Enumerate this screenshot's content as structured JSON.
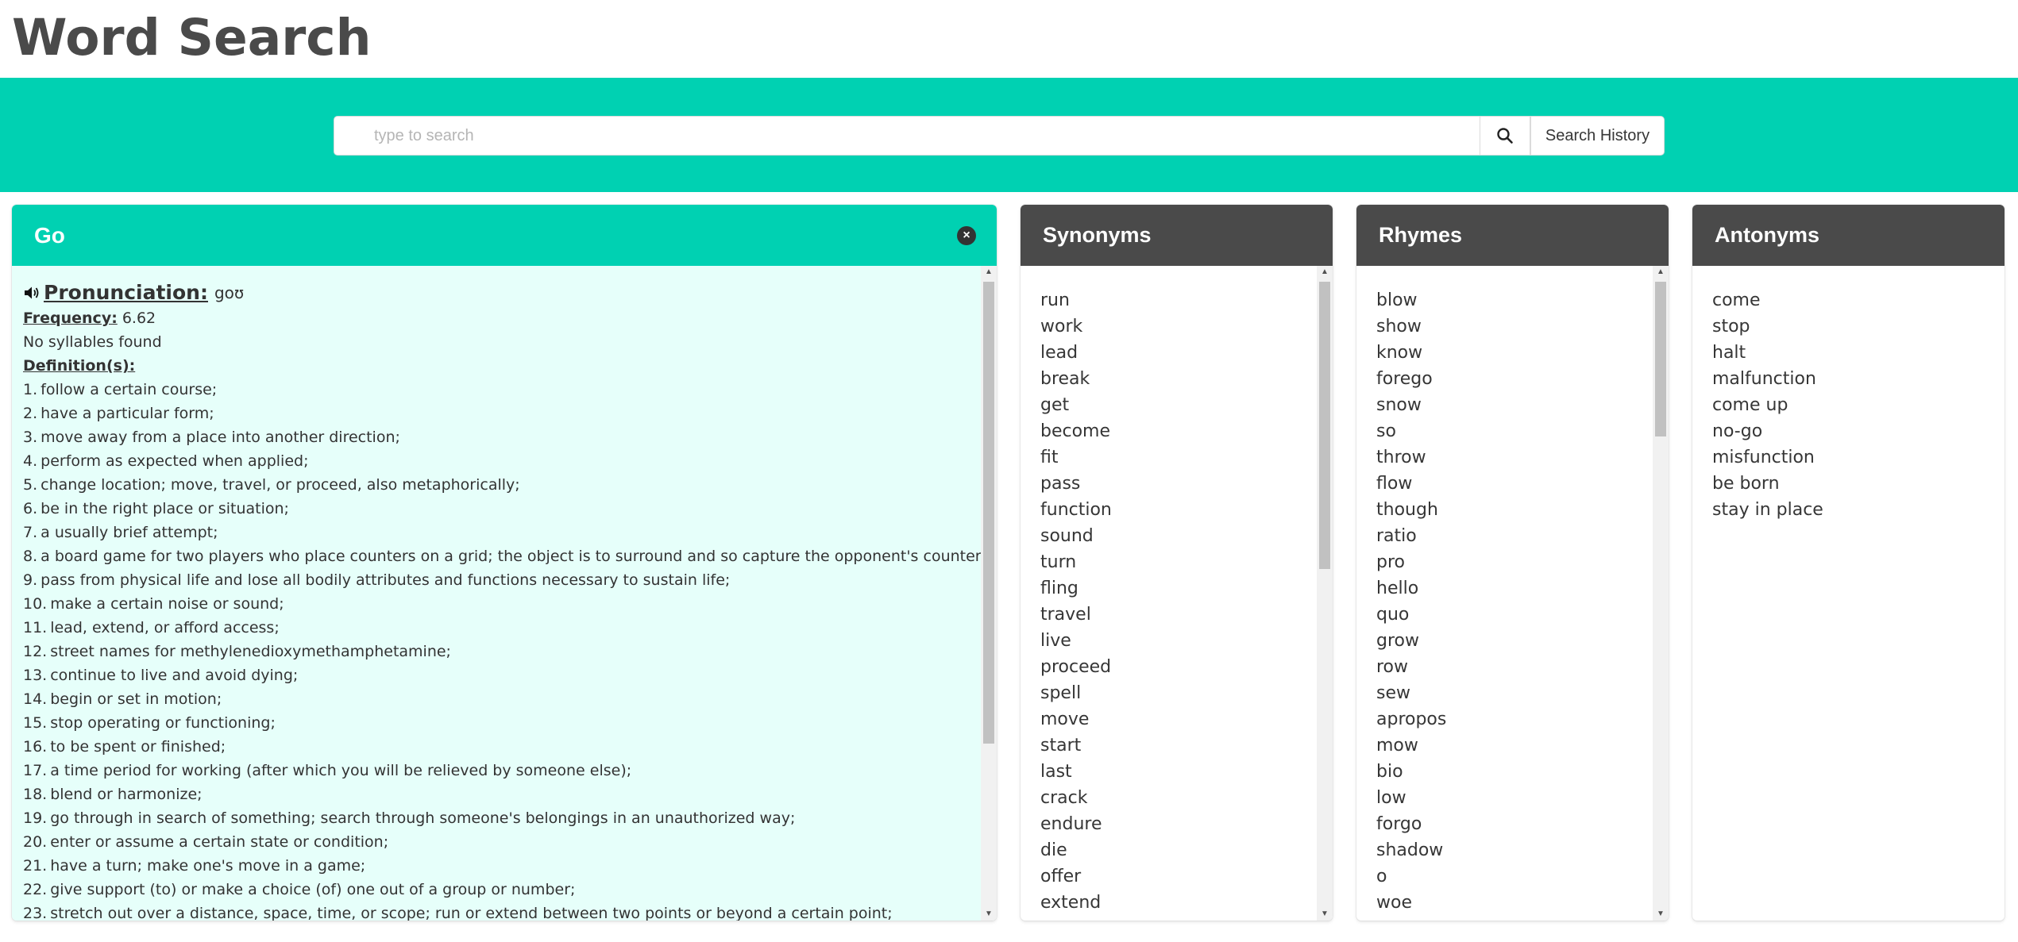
{
  "app": {
    "title": "Word Search"
  },
  "search": {
    "placeholder": "type to search",
    "value": "",
    "history_label": "Search History"
  },
  "definition_panel": {
    "word": "Go",
    "pronunciation_label": "Pronunciation:",
    "pronunciation": "goʊ",
    "frequency_label": "Frequency:",
    "frequency": "6.62",
    "syllables": "No syllables found",
    "definitions_label": "Definition(s):",
    "definitions": [
      "follow a certain course;",
      "have a particular form;",
      "move away from a place into another direction;",
      "perform as expected when applied;",
      "change location; move, travel, or proceed, also metaphorically;",
      "be in the right place or situation;",
      "a usually brief attempt;",
      "a board game for two players who place counters on a grid; the object is to surround and so capture the opponent's counters;",
      "pass from physical life and lose all bodily attributes and functions necessary to sustain life;",
      "make a certain noise or sound;",
      "lead, extend, or afford access;",
      "street names for methylenedioxymethamphetamine;",
      "continue to live and avoid dying;",
      "begin or set in motion;",
      "stop operating or functioning;",
      "to be spent or finished;",
      "a time period for working (after which you will be relieved by someone else);",
      "blend or harmonize;",
      "go through in search of something; search through someone's belongings in an unauthorized way;",
      "enter or assume a certain state or condition;",
      "have a turn; make one's move in a game;",
      "give support (to) or make a choice (of) one out of a group or number;",
      "stretch out over a distance, space, time, or scope; run or extend between two points or beyond a certain point;"
    ]
  },
  "synonyms": {
    "title": "Synonyms",
    "words": [
      "run",
      "work",
      "lead",
      "break",
      "get",
      "become",
      "fit",
      "pass",
      "function",
      "sound",
      "turn",
      "fling",
      "travel",
      "live",
      "proceed",
      "spell",
      "move",
      "start",
      "last",
      "crack",
      "endure",
      "die",
      "offer",
      "extend"
    ]
  },
  "rhymes": {
    "title": "Rhymes",
    "words": [
      "blow",
      "show",
      "know",
      "forego",
      "snow",
      "so",
      "throw",
      "flow",
      "though",
      "ratio",
      "pro",
      "hello",
      "quo",
      "grow",
      "row",
      "sew",
      "apropos",
      "mow",
      "bio",
      "low",
      "forgo",
      "shadow",
      "o",
      "woe"
    ]
  },
  "antonyms": {
    "title": "Antonyms",
    "words": [
      "come",
      "stop",
      "halt",
      "malfunction",
      "come up",
      "no-go",
      "misfunction",
      "be born",
      "stay in place"
    ]
  },
  "icons": {
    "search": "search-icon",
    "close": "close-icon",
    "speaker": "speaker-icon"
  },
  "colors": {
    "accent": "#00d1b2",
    "dark": "#4a4a4a",
    "definition_bg": "#e6fffa"
  }
}
